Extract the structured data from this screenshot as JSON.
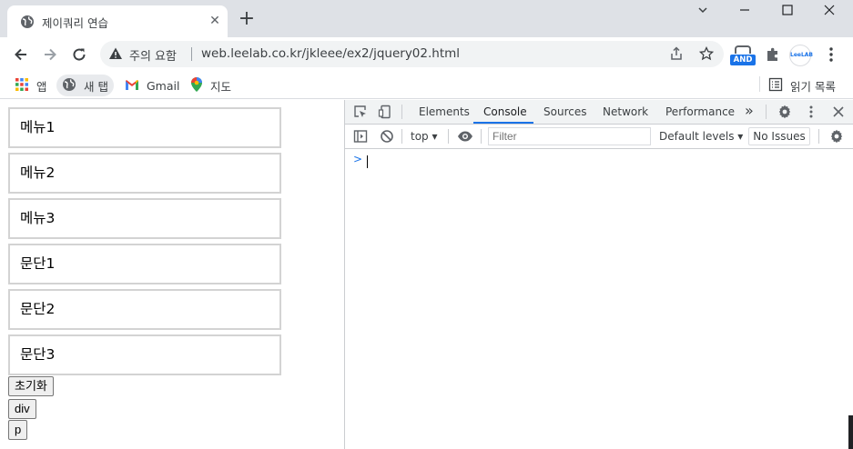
{
  "browser": {
    "tab_title": "제이쿼리 연습",
    "tab_close": "✕",
    "new_tab": "+",
    "security_warning": "주의 요함",
    "url": "web.leelab.co.kr/jkleee/ex2/jquery02.html",
    "extensions": {
      "and_label": "AND",
      "leelab_label": "LeeLAB"
    },
    "bookmarks": [
      {
        "label": "앱",
        "icon": "apps-grid-icon"
      },
      {
        "label": "새 탭",
        "icon": "globe-icon"
      },
      {
        "label": "Gmail",
        "icon": "gmail-icon"
      },
      {
        "label": "지도",
        "icon": "maps-pin-icon"
      }
    ],
    "reading_list": "읽기 목록"
  },
  "page": {
    "boxes": [
      "메뉴1",
      "메뉴2",
      "메뉴3",
      "문단1",
      "문단2",
      "문단3"
    ],
    "buttons": [
      "초기화",
      "div",
      "p"
    ]
  },
  "devtools": {
    "tabs": [
      "Elements",
      "Console",
      "Sources",
      "Network",
      "Performance"
    ],
    "active_tab": "Console",
    "more_tabs": "»",
    "context": "top",
    "filter_placeholder": "Filter",
    "levels": "Default levels",
    "issues": "No Issues",
    "prompt": ">",
    "accent_color": "#1a73e8"
  }
}
